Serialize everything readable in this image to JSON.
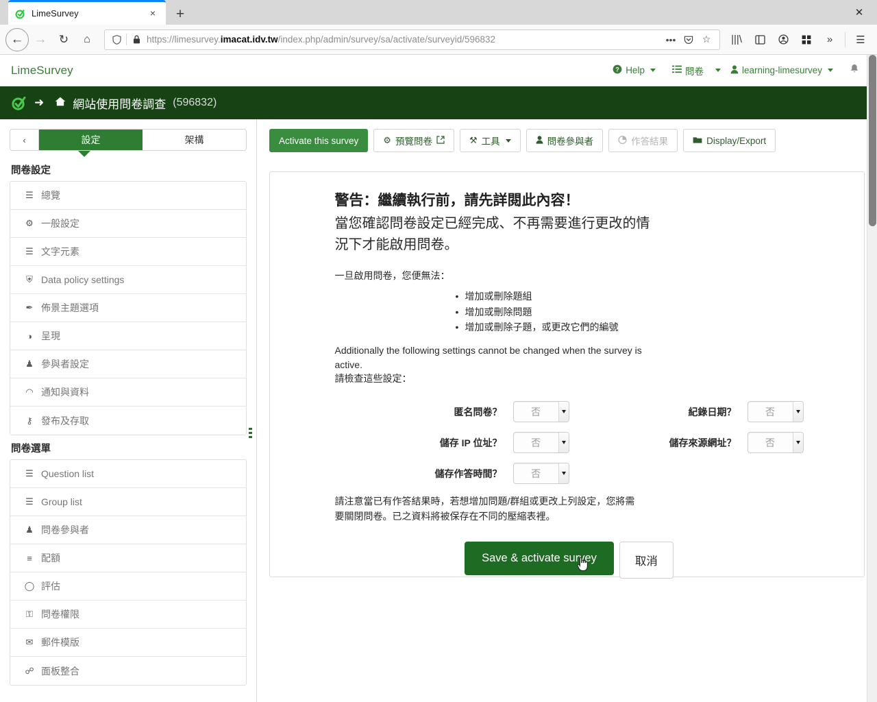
{
  "browser": {
    "tab": {
      "title": "LimeSurvey",
      "favicon": "limesurvey-icon",
      "close": "×"
    },
    "new_tab": "+",
    "window_close": "✕",
    "nav": {
      "back": "←",
      "forward": "→",
      "reload": "↻",
      "home": "⌂"
    },
    "url": {
      "full": "https://limesurvey.imacat.idv.tw/index.php/admin/survey/sa/activate/surveyid/596832",
      "prefix": "https://limesurvey.",
      "domain": "imacat.idv.tw",
      "path": "/index.php/admin/survey/sa/activate/surveyid/596832",
      "shield": "shield-icon",
      "lock": "lock-icon",
      "menu": "•••",
      "pocket": "☉",
      "bookmark": "☆"
    },
    "toolbar_icons": {
      "library": "|||\\",
      "sidebar": "▣",
      "account": "⓪",
      "extensions": "▓",
      "overflow": "»",
      "menu": "☰"
    }
  },
  "topbar": {
    "brand": "LimeSurvey",
    "help": "Help",
    "surveys": "問卷",
    "user": "learning-limesurvey",
    "bell": "🔔"
  },
  "titlebar": {
    "arrow": "➜",
    "home": "⌂",
    "survey_name": "網站使用問卷調查",
    "survey_id": "(596832)"
  },
  "sidebar": {
    "collapse": "‹",
    "tabs": [
      {
        "label": "設定",
        "active": true
      },
      {
        "label": "架構",
        "active": false
      }
    ],
    "sections": [
      {
        "title": "問卷設定",
        "items": [
          {
            "icon": "☰",
            "icon_name": "list-icon",
            "label": "總覽"
          },
          {
            "icon": "⚙",
            "icon_name": "gears-icon",
            "label": "一般設定"
          },
          {
            "icon": "☰",
            "icon_name": "document-icon",
            "label": "文字元素"
          },
          {
            "icon": "⛨",
            "icon_name": "shield-icon",
            "label": "Data policy settings"
          },
          {
            "icon": "✒",
            "icon_name": "paintbrush-icon",
            "label": "佈景主題選項"
          },
          {
            "icon": "◑",
            "icon_name": "eye-slash-icon",
            "label": "呈現"
          },
          {
            "icon": "♟",
            "icon_name": "users-icon",
            "label": "參與者設定"
          },
          {
            "icon": "◠",
            "icon_name": "rss-icon",
            "label": "通知與資料"
          },
          {
            "icon": "⚷",
            "icon_name": "key-icon",
            "label": "發布及存取"
          }
        ]
      },
      {
        "title": "問卷選單",
        "items": [
          {
            "icon": "☰",
            "icon_name": "list-icon",
            "label": "Question list"
          },
          {
            "icon": "☰",
            "icon_name": "list-icon",
            "label": "Group list"
          },
          {
            "icon": "♟",
            "icon_name": "user-icon",
            "label": "問卷參與者"
          },
          {
            "icon": "≡",
            "icon_name": "quota-icon",
            "label": "配額"
          },
          {
            "icon": "◯",
            "icon_name": "comment-icon",
            "label": "評估"
          },
          {
            "icon": "⚿",
            "icon_name": "lock-icon",
            "label": "問卷權限"
          },
          {
            "icon": "✉",
            "icon_name": "envelope-icon",
            "label": "郵件模版"
          },
          {
            "icon": "☍",
            "icon_name": "link-icon",
            "label": "面板整合"
          }
        ]
      }
    ],
    "drag_handle": "sidebar-drag-handle"
  },
  "toolbar": {
    "buttons": [
      {
        "label": "Activate this survey",
        "icon": "",
        "icon_name": "",
        "style": "primary",
        "caret": false
      },
      {
        "label": "預覽問卷",
        "icon": "⚙",
        "icon_name": "gear-icon",
        "style": "default",
        "caret": false,
        "suffix": "↗"
      },
      {
        "label": "工具",
        "icon": "⚒",
        "icon_name": "tools-icon",
        "style": "default",
        "caret": true
      },
      {
        "label": "問卷參與者",
        "icon": "♟",
        "icon_name": "user-icon",
        "style": "default",
        "caret": false
      },
      {
        "label": "作答結果",
        "icon": "◔",
        "icon_name": "chart-icon",
        "style": "disabled",
        "caret": false
      },
      {
        "label": "Display/Export",
        "icon": "✉",
        "icon_name": "folder-icon",
        "style": "default",
        "caret": false
      }
    ]
  },
  "panel": {
    "heading": "警告：繼續執行前，請先詳閱此內容！",
    "subheading": "當您確認問卷設定已經完成、不再需要進行更改的情況下才能啟用問卷。",
    "intro": "一旦啟用問卷，您便無法：",
    "restrictions": [
      "增加或刪除題組",
      "增加或刪除問題",
      "增加或刪除子題，或更改它們的編號"
    ],
    "additional_en": "Additionally the following settings cannot be changed when the survey is active.",
    "additional_zh": "請檢查這些設定：",
    "settings": [
      {
        "label": "匿名問卷？",
        "value": "否"
      },
      {
        "label": "紀錄日期？",
        "value": "否"
      },
      {
        "label": "儲存 IP 位址？",
        "value": "否"
      },
      {
        "label": "儲存來源網址？",
        "value": "否"
      },
      {
        "label": "儲存作答時間？",
        "value": "否"
      }
    ],
    "note": "請注意當已有作答結果時，若想增加問題/群組或更改上列設定，您將需要關閉問卷。已之資料將被保存在不同的壓縮表裡。",
    "activate_button": "Save & activate survey",
    "cancel_button": "取消"
  },
  "colors": {
    "header_dark_green": "#174214",
    "accent_green": "#2f7d32",
    "button_green": "#1e6b23",
    "toolbar_green": "#3a8c3f",
    "brand_green": "#3b7d37",
    "tab_accent_blue": "#0a84ff"
  }
}
